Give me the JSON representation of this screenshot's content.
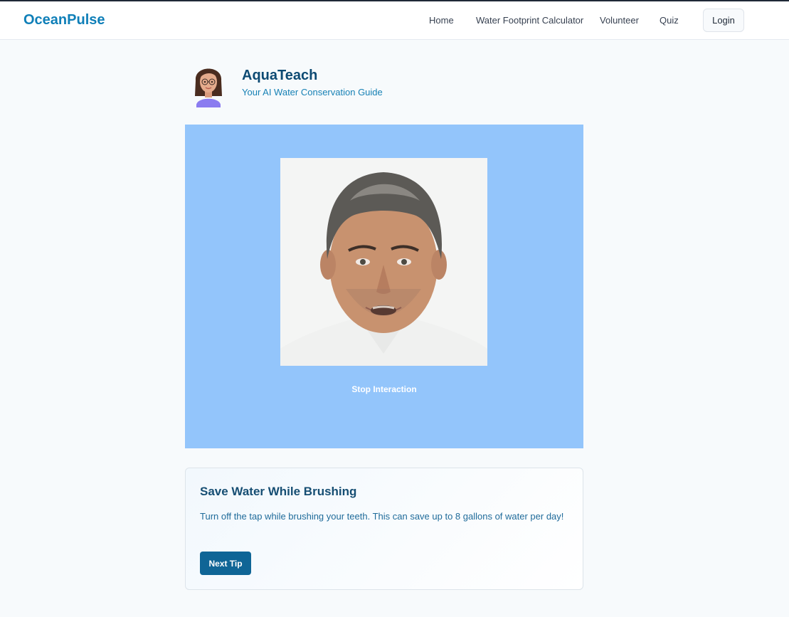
{
  "nav": {
    "brand": "OceanPulse",
    "links": [
      "Home",
      "Water Footprint Calculator",
      "Volunteer",
      "Quiz"
    ],
    "login_label": "Login"
  },
  "agent": {
    "name": "AquaTeach",
    "subtitle": "Your AI Water Conservation Guide"
  },
  "video": {
    "stop_label": "Stop Interaction",
    "panel_color": "#93c5fb"
  },
  "tip": {
    "title": "Save Water While Brushing",
    "body": "Turn off the tap while brushing your teeth. This can save up to 8 gallons of water per day!",
    "next_label": "Next Tip"
  },
  "colors": {
    "brand": "#0f7fb8",
    "button": "#0f6596"
  }
}
